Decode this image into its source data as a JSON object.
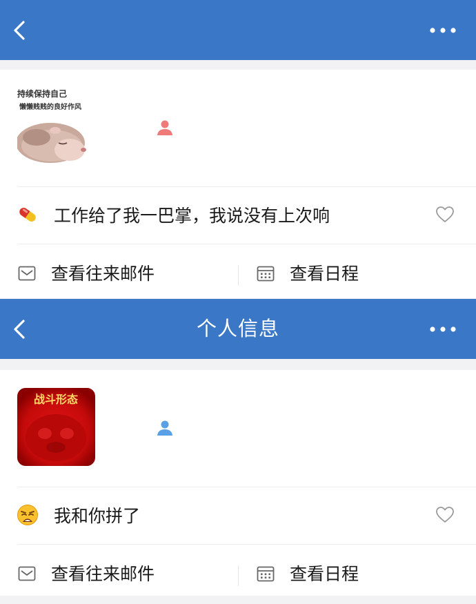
{
  "colors": {
    "nav_bg": "#3a78c7",
    "card_bg": "#ffffff",
    "page_bg": "#f2f2f4",
    "divider": "#ececec",
    "contact_icon_pink": "#ef7a7a",
    "contact_icon_blue": "#5aa0e6"
  },
  "icons": {
    "back": "chevron-left-icon",
    "more": "ellipsis-icon",
    "contact": "person-icon",
    "like": "heart-outline-icon",
    "mail": "envelope-icon",
    "calendar": "calendar-icon"
  },
  "panels": [
    {
      "title": "",
      "avatar_caption_line1": "持续保持自己",
      "avatar_caption_line2": "懒懒贱贱的良好作风",
      "status_emoji": "pill",
      "status_text": "工作给了我一巴掌，我说没有上次响",
      "view_mail_label": "查看往来邮件",
      "view_schedule_label": "查看日程"
    },
    {
      "title": "个人信息",
      "avatar_caption": "战斗形态",
      "status_emoji": "weary-face",
      "status_text": "我和你拼了",
      "view_mail_label": "查看往来邮件",
      "view_schedule_label": "查看日程"
    }
  ]
}
